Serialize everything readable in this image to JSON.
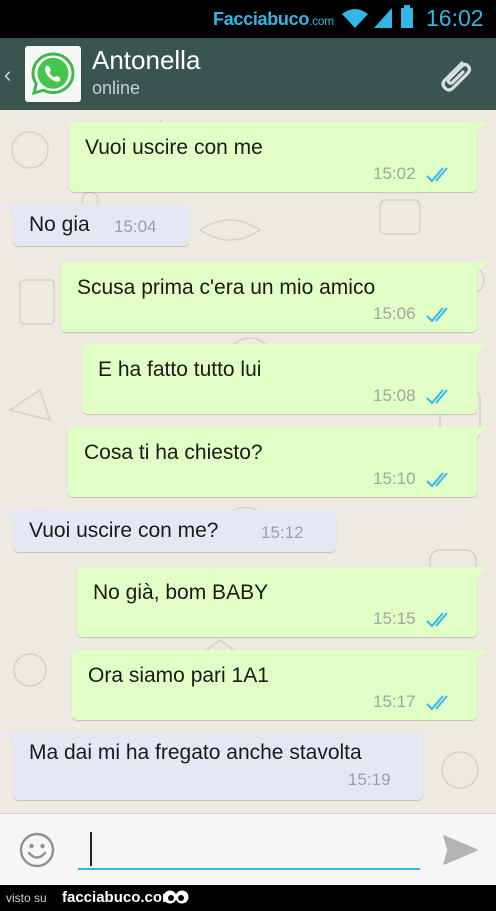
{
  "status_bar": {
    "watermark_main": "Facciabuco",
    "watermark_suffix": ".com",
    "time": "16:02",
    "icons": [
      "wifi-icon",
      "signal-icon",
      "battery-icon"
    ]
  },
  "header": {
    "back_glyph": "‹",
    "contact_name": "Antonella",
    "contact_status": "online",
    "icons": [
      "whatsapp-avatar-icon",
      "paperclip-icon"
    ]
  },
  "messages": [
    {
      "direction": "out",
      "text": "Vuoi uscire con me",
      "time": "15:02",
      "read": true
    },
    {
      "direction": "in",
      "text": "No gia",
      "time": "15:04"
    },
    {
      "direction": "out",
      "text": "Scusa prima c'era un mio amico",
      "time": "15:06",
      "read": true
    },
    {
      "direction": "out",
      "text": "E ha fatto tutto lui",
      "time": "15:08",
      "read": true
    },
    {
      "direction": "out",
      "text": "Cosa ti ha chiesto?",
      "time": "15:10",
      "read": true
    },
    {
      "direction": "in",
      "text": "Vuoi uscire con me?",
      "time": "15:12"
    },
    {
      "direction": "out",
      "text": "No già, bom BABY",
      "time": "15:15",
      "read": true
    },
    {
      "direction": "out",
      "text": "Ora siamo pari 1A1",
      "time": "15:17",
      "read": true
    },
    {
      "direction": "in",
      "text": "Ma dai mi ha fregato anche stavolta",
      "time": "15:19"
    }
  ],
  "composer": {
    "value": "",
    "icons": [
      "emoji-icon",
      "send-icon"
    ]
  },
  "footer": {
    "visto": "visto su",
    "site": "facciabuco.com"
  },
  "colors": {
    "header": "#3a5450",
    "outgoing_bubble": "#e1fec6",
    "incoming_bubble": "#e4e8f5",
    "read_ticks": "#34b7f1",
    "accent": "#33b5e5"
  }
}
